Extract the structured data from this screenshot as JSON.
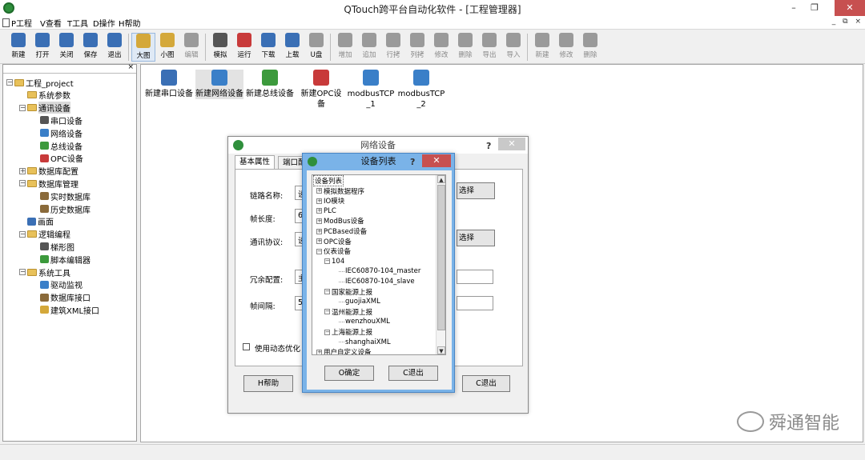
{
  "window": {
    "title": "QTouch跨平台自动化软件 - [工程管理器]",
    "minimize": "–",
    "restore": "❐",
    "close": "✕",
    "mdi_controls": "_ ⧉ ×"
  },
  "menu": {
    "items": [
      {
        "label": "P工程"
      },
      {
        "label": "V查看"
      },
      {
        "label": "T工具"
      },
      {
        "label": "D操作"
      },
      {
        "label": "H帮助"
      }
    ]
  },
  "toolbar": {
    "groups": [
      [
        {
          "label": "新建",
          "icon": "new-icon",
          "color": "#3a6fb5",
          "enabled": true
        },
        {
          "label": "打开",
          "icon": "open-icon",
          "color": "#3a6fb5",
          "enabled": true
        },
        {
          "label": "关闭",
          "icon": "close-doc-icon",
          "color": "#3a6fb5",
          "enabled": true
        },
        {
          "label": "保存",
          "icon": "save-icon",
          "color": "#3a6fb5",
          "enabled": true
        },
        {
          "label": "退出",
          "icon": "exit-icon",
          "color": "#3a6fb5",
          "enabled": true
        }
      ],
      [
        {
          "label": "大图",
          "icon": "large-icon",
          "color": "#d4a83a",
          "enabled": true,
          "active": true
        },
        {
          "label": "小图",
          "icon": "small-icon",
          "color": "#d4a83a",
          "enabled": true
        },
        {
          "label": "编辑",
          "icon": "edit-icon",
          "color": "#9a9a9a",
          "enabled": false
        }
      ],
      [
        {
          "label": "模拟",
          "icon": "simulate-icon",
          "color": "#555555",
          "enabled": true
        },
        {
          "label": "运行",
          "icon": "run-icon",
          "color": "#c83a3a",
          "enabled": true
        },
        {
          "label": "下载",
          "icon": "download-icon",
          "color": "#3a6fb5",
          "enabled": true
        },
        {
          "label": "上载",
          "icon": "upload-icon",
          "color": "#3a6fb5",
          "enabled": true
        },
        {
          "label": "U盘",
          "icon": "usb-icon",
          "color": "#9a9a9a",
          "enabled": true
        }
      ],
      [
        {
          "label": "增加",
          "icon": "add-icon",
          "color": "#9a9a9a",
          "enabled": false
        },
        {
          "label": "追加",
          "icon": "append-icon",
          "color": "#9a9a9a",
          "enabled": false
        },
        {
          "label": "行拷",
          "icon": "row-copy-icon",
          "color": "#9a9a9a",
          "enabled": false
        },
        {
          "label": "列拷",
          "icon": "col-copy-icon",
          "color": "#9a9a9a",
          "enabled": false
        },
        {
          "label": "修改",
          "icon": "modify-icon",
          "color": "#9a9a9a",
          "enabled": false
        },
        {
          "label": "删除",
          "icon": "delete-icon",
          "color": "#9a9a9a",
          "enabled": false
        },
        {
          "label": "导出",
          "icon": "export-icon",
          "color": "#9a9a9a",
          "enabled": false
        },
        {
          "label": "导入",
          "icon": "import-icon",
          "color": "#9a9a9a",
          "enabled": false
        }
      ],
      [
        {
          "label": "新建",
          "icon": "new2-icon",
          "color": "#9a9a9a",
          "enabled": false
        },
        {
          "label": "修改",
          "icon": "modify2-icon",
          "color": "#9a9a9a",
          "enabled": false
        },
        {
          "label": "删除",
          "icon": "delete2-icon",
          "color": "#9a9a9a",
          "enabled": false
        }
      ]
    ]
  },
  "tree": {
    "close": "×",
    "nodes": [
      {
        "label": "工程_project",
        "level": 0,
        "expander": "−",
        "icon": "folder"
      },
      {
        "label": "系统参数",
        "level": 1,
        "expander": "",
        "icon": "folder"
      },
      {
        "label": "通讯设备",
        "level": 1,
        "expander": "−",
        "icon": "folder",
        "selected": true
      },
      {
        "label": "串口设备",
        "level": 2,
        "expander": "",
        "icon": "serial-icon"
      },
      {
        "label": "网络设备",
        "level": 2,
        "expander": "",
        "icon": "network-icon"
      },
      {
        "label": "总线设备",
        "level": 2,
        "expander": "",
        "icon": "bus-icon"
      },
      {
        "label": "OPC设备",
        "level": 2,
        "expander": "",
        "icon": "opc-icon"
      },
      {
        "label": "数据库配置",
        "level": 1,
        "expander": "+",
        "icon": "folder"
      },
      {
        "label": "数据库管理",
        "level": 1,
        "expander": "−",
        "icon": "folder"
      },
      {
        "label": "实时数据库",
        "level": 2,
        "expander": "",
        "icon": "rtdb-icon"
      },
      {
        "label": "历史数据库",
        "level": 2,
        "expander": "",
        "icon": "histdb-icon"
      },
      {
        "label": "画面",
        "level": 1,
        "expander": "",
        "icon": "screen-icon"
      },
      {
        "label": "逻辑编程",
        "level": 1,
        "expander": "−",
        "icon": "folder"
      },
      {
        "label": "梯形图",
        "level": 2,
        "expander": "",
        "icon": "ladder-icon"
      },
      {
        "label": "脚本编辑器",
        "level": 2,
        "expander": "",
        "icon": "script-icon"
      },
      {
        "label": "系统工具",
        "level": 1,
        "expander": "−",
        "icon": "folder"
      },
      {
        "label": "驱动监视",
        "level": 2,
        "expander": "",
        "icon": "driver-icon"
      },
      {
        "label": "数据库接口",
        "level": 2,
        "expander": "",
        "icon": "dbif-icon"
      },
      {
        "label": "建筑XML接口",
        "level": 2,
        "expander": "",
        "icon": "xml-icon"
      }
    ]
  },
  "workspace": {
    "items": [
      {
        "label": "新建串口设备",
        "icon": "serial-device-icon",
        "color": "#3a6fb5"
      },
      {
        "label": "新建网络设备",
        "icon": "network-device-icon",
        "color": "#3a7fc8",
        "selected": true
      },
      {
        "label": "新建总线设备",
        "icon": "bus-device-icon",
        "color": "#3c9a3c"
      },
      {
        "label": "新建OPC设备",
        "icon": "opc-device-icon",
        "color": "#c83a3a"
      },
      {
        "label": "modbusTCP_1",
        "icon": "network-device-icon",
        "color": "#3a7fc8"
      },
      {
        "label": "modbusTCP_2",
        "icon": "network-device-icon",
        "color": "#3a7fc8"
      }
    ]
  },
  "net_dialog": {
    "title": "网络设备",
    "help": "?",
    "close": "✕",
    "tabs": [
      "基本属性",
      "端口配"
    ],
    "fields": [
      {
        "label": "链路名称:",
        "value": "设"
      },
      {
        "label": "帧长度:",
        "value": "64"
      },
      {
        "label": "通讯协议:",
        "value": "设"
      },
      {
        "label": "冗余配置:",
        "value": "主"
      },
      {
        "label": "帧间隔:",
        "value": "50"
      }
    ],
    "select_buttons": [
      "选择",
      "选择"
    ],
    "dynamic_opt": "使用动态优化",
    "help_btn": "H帮助",
    "exit_btn": "C退出"
  },
  "list_dialog": {
    "title": "设备列表",
    "help": "?",
    "close": "✕",
    "ok": "O确定",
    "cancel": "C退出",
    "nodes": [
      {
        "label": "设备列表",
        "level": 0,
        "expander": "",
        "root": true
      },
      {
        "label": "模拟数据程序",
        "level": 1,
        "expander": "+"
      },
      {
        "label": "IO模块",
        "level": 1,
        "expander": "+"
      },
      {
        "label": "PLC",
        "level": 1,
        "expander": "+"
      },
      {
        "label": "ModBus设备",
        "level": 1,
        "expander": "+"
      },
      {
        "label": "PCBased设备",
        "level": 1,
        "expander": "+"
      },
      {
        "label": "OPC设备",
        "level": 1,
        "expander": "+"
      },
      {
        "label": "仪表设备",
        "level": 1,
        "expander": "−"
      },
      {
        "label": "104",
        "level": 2,
        "expander": "−"
      },
      {
        "label": "IEC60870-104_master",
        "level": 3,
        "expander": ""
      },
      {
        "label": "IEC60870-104_slave",
        "level": 3,
        "expander": ""
      },
      {
        "label": "国家能源上报",
        "level": 2,
        "expander": "−"
      },
      {
        "label": "guojiaXML",
        "level": 3,
        "expander": ""
      },
      {
        "label": "温州能源上报",
        "level": 2,
        "expander": "−"
      },
      {
        "label": "wenzhouXML",
        "level": 3,
        "expander": ""
      },
      {
        "label": "上海能源上报",
        "level": 2,
        "expander": "−"
      },
      {
        "label": "shanghaiXML",
        "level": 3,
        "expander": ""
      },
      {
        "label": "用户自定义设备",
        "level": 1,
        "expander": "+"
      }
    ]
  },
  "watermark": {
    "text": "舜通智能"
  }
}
